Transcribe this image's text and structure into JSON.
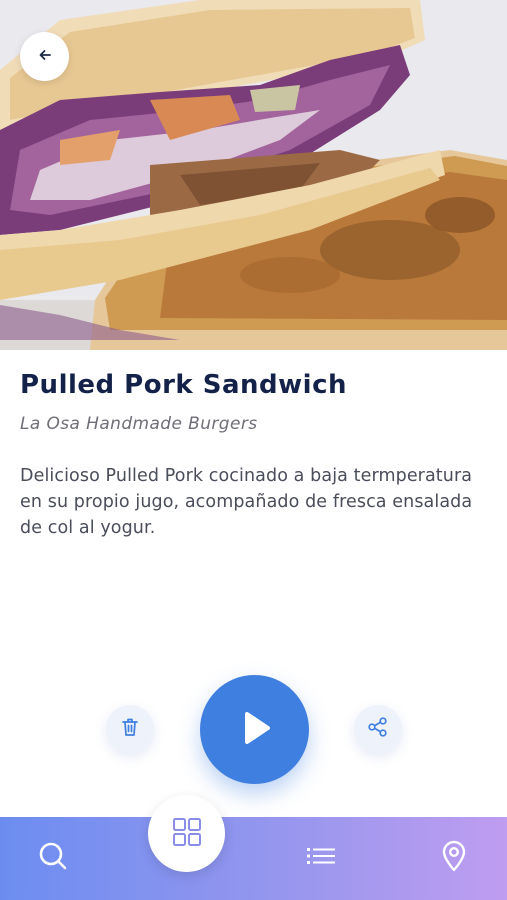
{
  "product": {
    "title": "Pulled Pork Sandwich",
    "restaurant": "La Osa Handmade Burgers",
    "description": "Delicioso Pulled Pork cocinado a baja termperatura en su propio jugo, acompañado de fresca ensalada de col al yogur."
  },
  "icons": {
    "back": "arrow-left-icon",
    "delete": "trash-icon",
    "play": "play-icon",
    "share": "share-icon",
    "search": "search-icon",
    "grid": "grid-icon",
    "list": "list-icon",
    "location": "location-pin-icon"
  },
  "colors": {
    "title": "#14224a",
    "accent": "#3f7fe0",
    "nav_gradient_start": "#6c8df0",
    "nav_gradient_end": "#bf9df0"
  }
}
